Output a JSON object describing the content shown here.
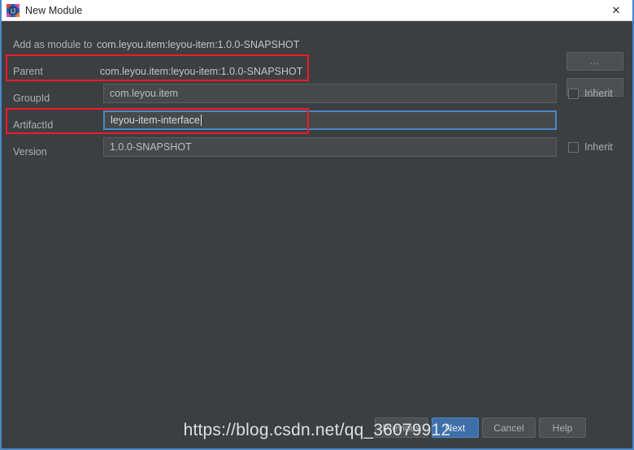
{
  "window": {
    "title": "New Module",
    "icon": "intellij-idea-icon",
    "close_label": "✕",
    "accent_color": "#4a88c7",
    "annotation_color": "#ee1c25"
  },
  "form": {
    "rows": [
      {
        "label": "Add as module to",
        "kind": "static",
        "value": "com.leyou.item:leyou-item:1.0.0-SNAPSHOT",
        "trailing": "dots-button",
        "trailing_label": "...",
        "annotated": false
      },
      {
        "label": "Parent",
        "kind": "static",
        "value": "com.leyou.item:leyou-item:1.0.0-SNAPSHOT",
        "trailing": "dots-button",
        "trailing_label": "...",
        "annotated": true
      },
      {
        "label": "GroupId",
        "kind": "input",
        "value": "com.leyou.item",
        "focused": false,
        "trailing": "inherit",
        "trailing_label": "Inherit",
        "checked": false,
        "annotated": false
      },
      {
        "label": "ArtifactId",
        "kind": "input",
        "value": "leyou-item-interface",
        "focused": true,
        "trailing": "none",
        "trailing_label": "",
        "annotated": true
      },
      {
        "label": "Version",
        "kind": "input",
        "value": "1.0.0-SNAPSHOT",
        "focused": false,
        "trailing": "inherit",
        "trailing_label": "Inherit",
        "checked": false,
        "annotated": false
      }
    ]
  },
  "footer": {
    "previous_label": "Previous",
    "next_label": "Next",
    "cancel_label": "Cancel",
    "help_label": "Help"
  },
  "watermark": {
    "text": "https://blog.csdn.net/qq_36079912"
  }
}
